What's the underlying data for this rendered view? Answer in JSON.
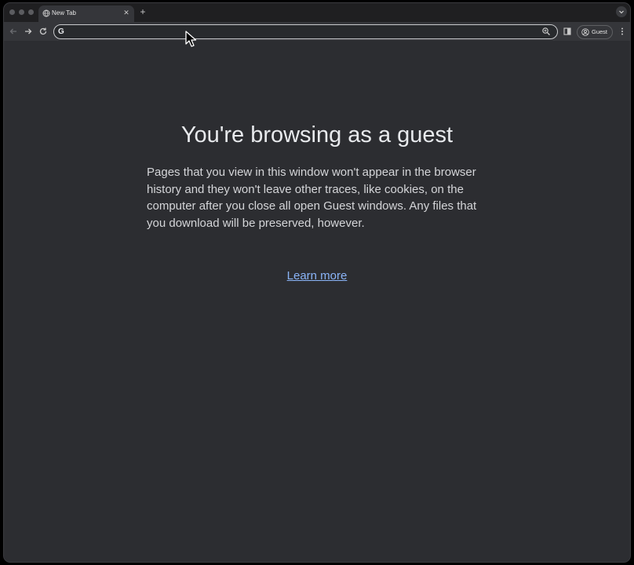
{
  "tab": {
    "title": "New Tab",
    "close": "✕"
  },
  "tabstrip": {
    "new_tab": "+"
  },
  "omnibox": {
    "logo": "G",
    "value": ""
  },
  "profile": {
    "label": "Guest"
  },
  "page": {
    "headline": "You're browsing as a guest",
    "body": "Pages that you view in this window won't appear in the browser history and they won't leave other traces, like cookies, on the computer after you close all open Guest windows. Any files that you download will be preserved, however.",
    "link": "Learn more"
  },
  "colors": {
    "background": "#2c2d31",
    "toolbar": "#35363a",
    "link": "#8ab4f8",
    "text": "#e8eaed"
  },
  "icons": [
    "close-icon",
    "back-icon",
    "forward-icon",
    "reload-icon",
    "zoom-icon",
    "side-panel-icon",
    "avatar-icon",
    "menu-icon",
    "tab-search-icon",
    "globe-icon"
  ]
}
